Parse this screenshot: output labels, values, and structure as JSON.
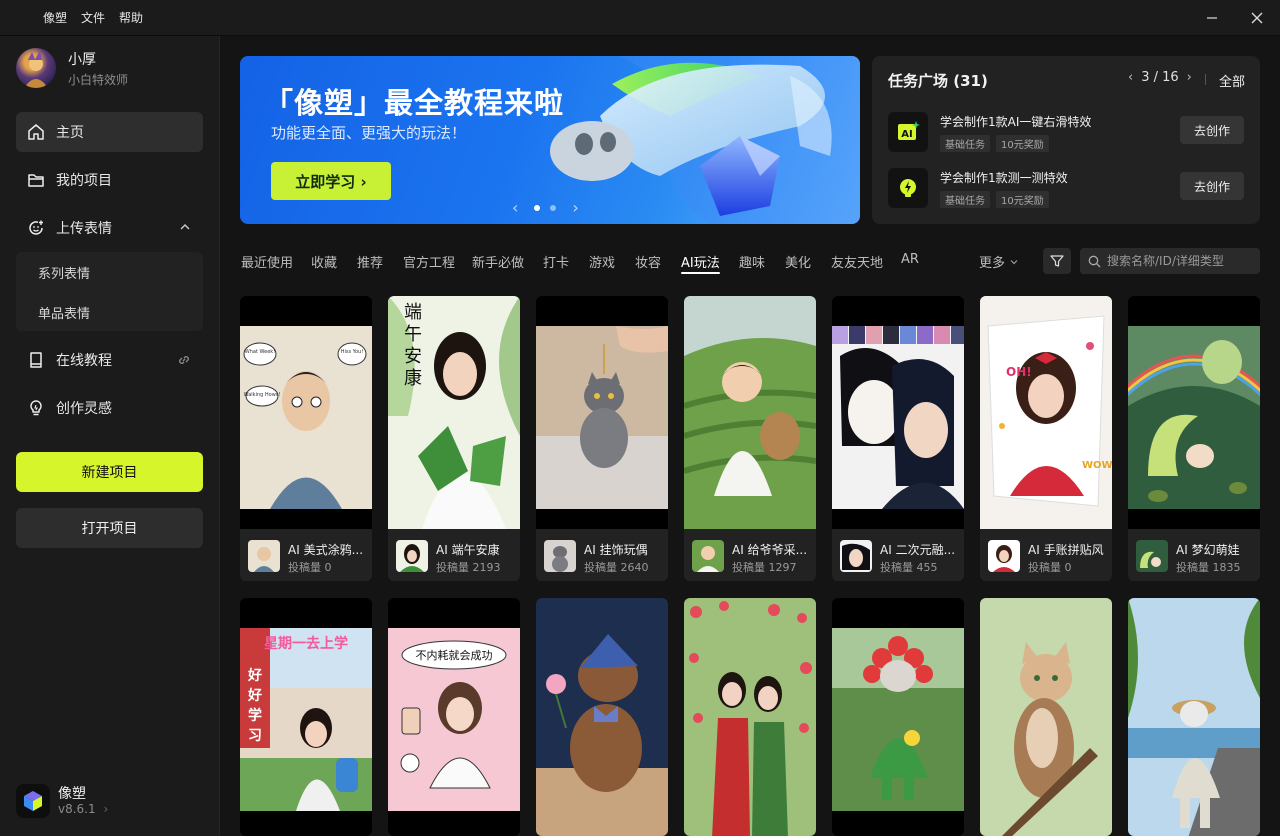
{
  "titlebar": {
    "menus": [
      "像塑",
      "文件",
      "帮助"
    ]
  },
  "user": {
    "name": "小厚",
    "subtitle": "小白特效师"
  },
  "nav": {
    "home": "主页",
    "projects": "我的项目",
    "upload": "上传表情",
    "upload_sub": [
      "系列表情",
      "单品表情"
    ],
    "tutorial": "在线教程",
    "inspiration": "创作灵感"
  },
  "actions": {
    "new_project": "新建项目",
    "open_project": "打开项目"
  },
  "brand": {
    "name": "像塑",
    "version": "v8.6.1"
  },
  "banner": {
    "title": "「像塑」最全教程来啦",
    "subtitle": "功能更全面、更强大的玩法！",
    "button": "立即学习 ›",
    "slide_index": 1,
    "slide_count": 2
  },
  "tasks": {
    "title": "任务广场 (31)",
    "pager": "3 / 16",
    "all": "全部",
    "items": [
      {
        "name": "学会制作1款AI一键右滑特效",
        "tags": [
          "基础任务",
          "10元奖励"
        ],
        "action": "去创作",
        "icon": "ai-icon"
      },
      {
        "name": "学会制作1款测一测特效",
        "tags": [
          "基础任务",
          "10元奖励"
        ],
        "action": "去创作",
        "icon": "bulb-bolt-icon"
      }
    ]
  },
  "tabs": [
    "最近使用",
    "收藏",
    "推荐",
    "官方工程",
    "新手必做",
    "打卡",
    "游戏",
    "妆容",
    "AI玩法",
    "趣味",
    "美化",
    "友友天地",
    "AR"
  ],
  "active_tab": "AI玩法",
  "more_label": "更多",
  "search": {
    "placeholder": "搜索名称/ID/详细类型"
  },
  "cards_row1": [
    {
      "title": "AI 美式涂鸦...",
      "stat": "投稿量 0"
    },
    {
      "title": "AI 端午安康",
      "stat": "投稿量 2193"
    },
    {
      "title": "AI 挂饰玩偶",
      "stat": "投稿量 2640"
    },
    {
      "title": "AI 给爷爷采...",
      "stat": "投稿量 1297"
    },
    {
      "title": "AI 二次元融...",
      "stat": "投稿量 455"
    },
    {
      "title": "AI 手账拼贴风",
      "stat": "投稿量 0"
    },
    {
      "title": "AI 梦幻萌娃",
      "stat": "投稿量 1835"
    }
  ],
  "thumb_text": {
    "bubbles": [
      "What Week!",
      "Hiss You!",
      "Walking Hows!"
    ],
    "duanwu": "端午安康",
    "wow": "WOW",
    "xingqi": "星期一去上学",
    "haohao": "好好学习",
    "buneihao": "不内耗就会成功"
  },
  "colors": {
    "accent": "#d6f52a",
    "banner_blue": "#1b74ef"
  }
}
